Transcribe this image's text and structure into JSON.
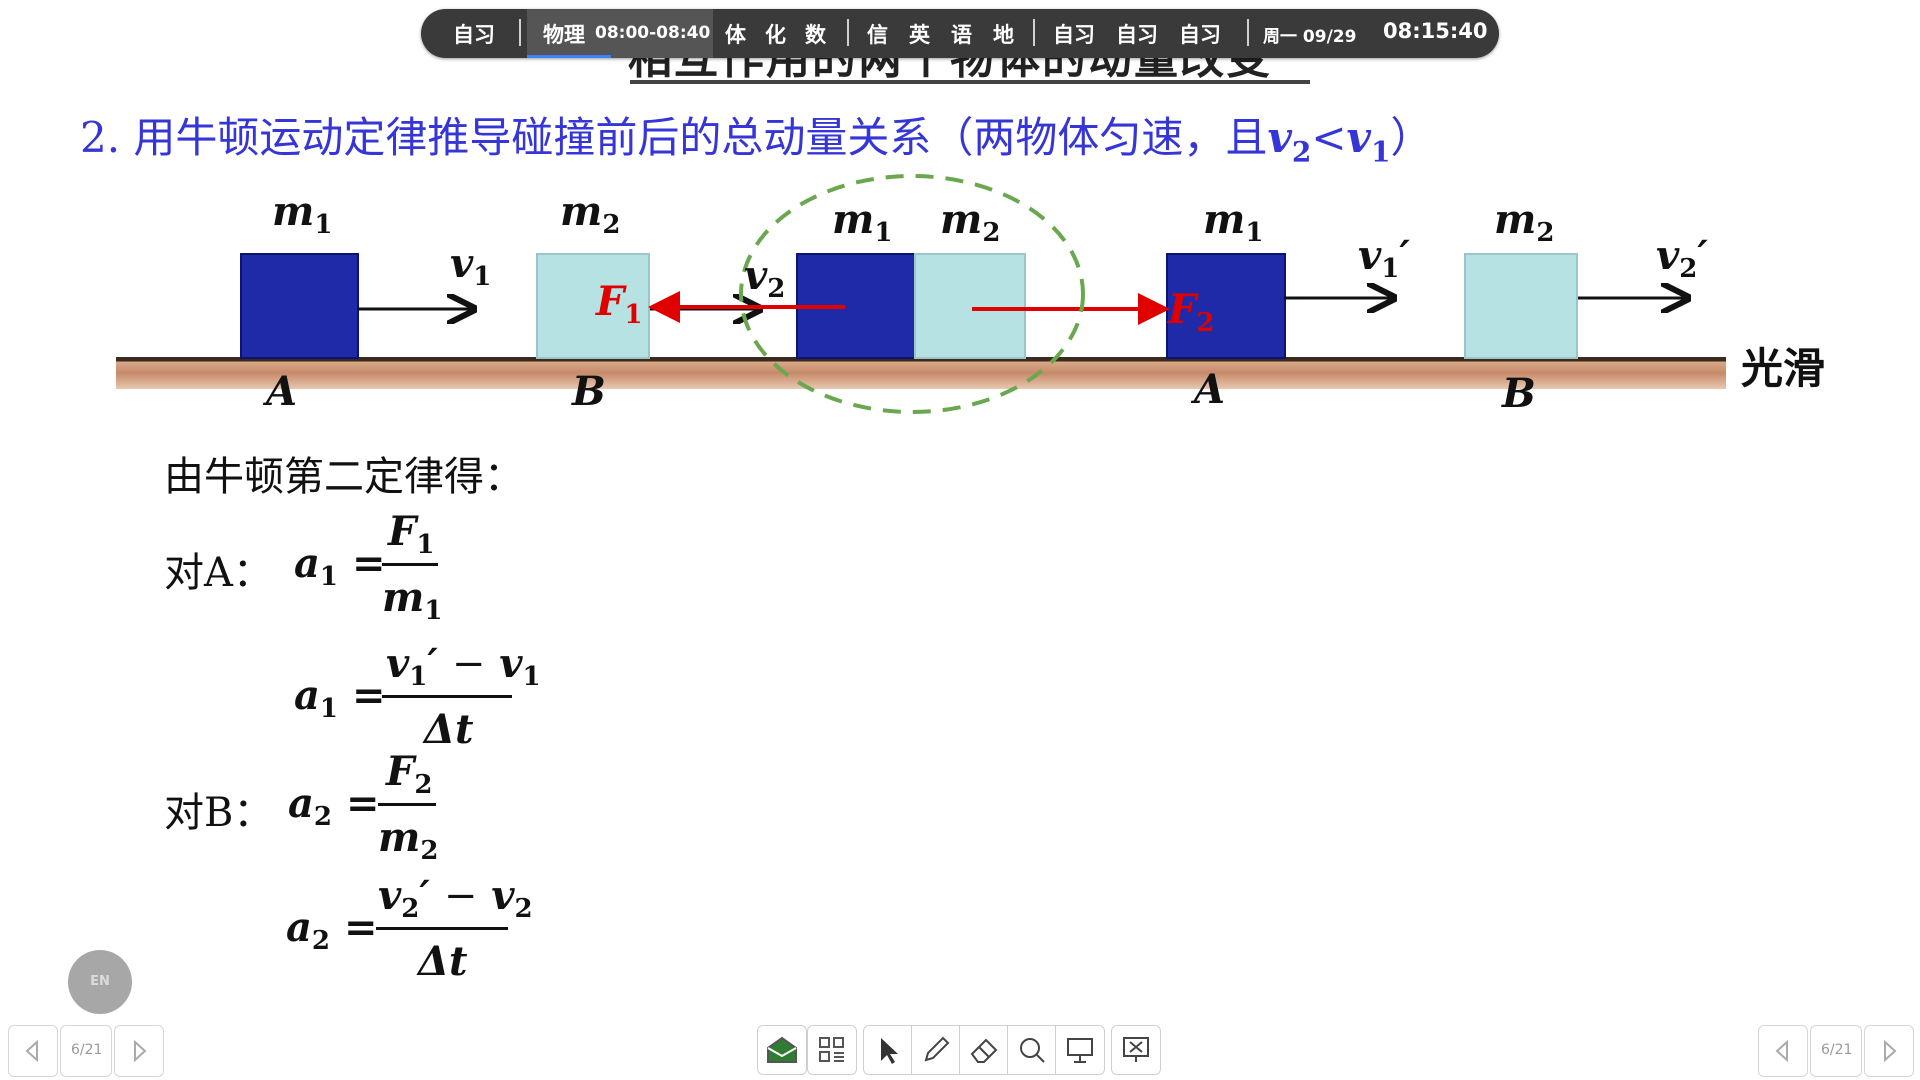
{
  "topbar": {
    "items": [
      "自习",
      "物理",
      "08:00-08:40",
      "体",
      "化",
      "数",
      "信",
      "英",
      "语",
      "地",
      "自习",
      "自习",
      "自习",
      "周一 09/29",
      "08:15:40"
    ]
  },
  "slide": {
    "title": "相互作用的两个物体的动量改变",
    "heading_prefix": "2. 用牛顿运动定律推导碰撞前后的总动量关系（两物体匀速，且",
    "heading_v2": "v",
    "heading_sub2": "2",
    "heading_lt": "<",
    "heading_v1": "v",
    "heading_sub1": "1",
    "heading_close": "）",
    "diagram": {
      "m": "m",
      "one": "1",
      "two": "2",
      "v": "v",
      "F": "F",
      "A": "A",
      "B": "B",
      "prime": "′",
      "smooth": "光滑"
    },
    "derivation": {
      "intro": "由牛顿第二定律得：",
      "forA": "对A：",
      "forB": "对B：",
      "a": "a",
      "eq": "=",
      "minus": "−",
      "delta_t": "Δt"
    }
  },
  "ui": {
    "en_button": "EN",
    "page_left": "6/21",
    "page_right": "6/21"
  }
}
